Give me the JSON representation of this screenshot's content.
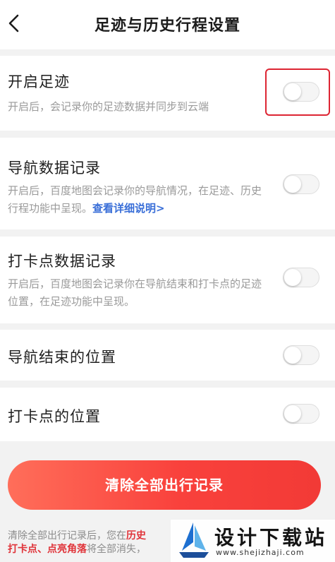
{
  "header": {
    "title": "足迹与历史行程设置",
    "back_icon": "chevron-left-icon"
  },
  "settings": [
    {
      "title": "开启足迹",
      "description": "开启后，会记录你的足迹数据并同步到云端",
      "enabled": false
    },
    {
      "title": "导航数据记录",
      "description": "开启后，百度地图会记录你的导航情况，在足迹、历史行程功能中呈现。",
      "link": "查看详细说明>",
      "enabled": false
    },
    {
      "title": "打卡点数据记录",
      "description": "开启后，百度地图会记录你在导航结束和打卡点的足迹位置，在足迹功能中呈现。",
      "enabled": false
    },
    {
      "title": "导航结束的位置",
      "enabled": false
    },
    {
      "title": "打卡点的位置",
      "enabled": false
    }
  ],
  "clear_button": {
    "label": "清除全部出行记录"
  },
  "bottom_note": {
    "part1": "清除全部出行记录后，您在",
    "highlight1": "历史",
    "highlight2": "打卡点、点亮角落",
    "part2": "将全部消失，"
  },
  "watermark": {
    "title": "设计下载站",
    "url": "www.shejizhaji.com"
  },
  "colors": {
    "accent": "#f9413c",
    "link": "#3a6fd8",
    "highlight_border": "#dd2533"
  }
}
